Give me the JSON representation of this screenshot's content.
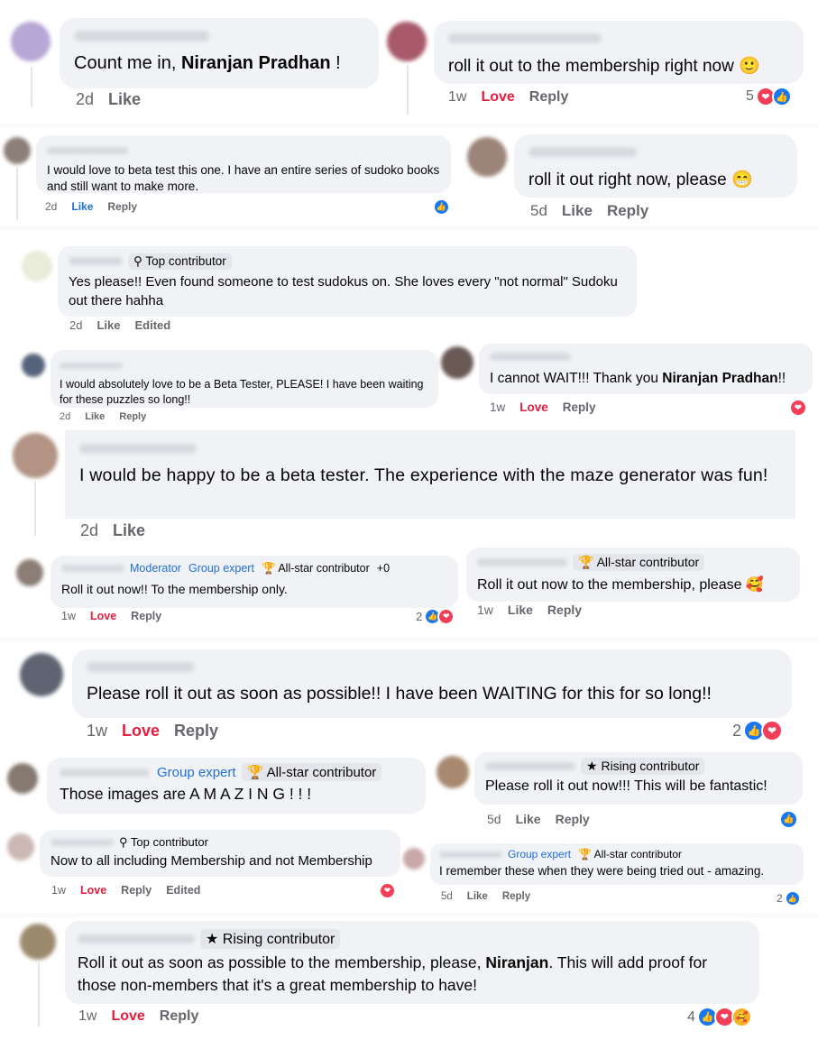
{
  "comments": [
    {
      "text_pre": "Count me in, ",
      "mention": "Niranjan Pradhan",
      "text_post": " !",
      "time": "2d",
      "like": "Like"
    },
    {
      "text": "roll it out to the membership right now 🙂",
      "time": "1w",
      "love": "Love",
      "reply": "Reply",
      "count": "5"
    },
    {
      "text": "I would love to beta test this one. I have an entire series of sudoko books and still want to make more.",
      "time": "2d",
      "like": "Like",
      "reply": "Reply"
    },
    {
      "text": "roll it out right now, please 😁",
      "time": "5d",
      "like": "Like",
      "reply": "Reply"
    },
    {
      "badge": "Top contributor",
      "text": "Yes please!! Even found someone to test sudokus on. She loves every \"not normal\" Sudoku out there hahha",
      "time": "2d",
      "like": "Like",
      "edited": "Edited"
    },
    {
      "text": "I would absolutely love to be a Beta Tester, PLEASE! I have been waiting for these puzzles so long!!",
      "time": "2d",
      "like": "Like",
      "reply": "Reply"
    },
    {
      "text_pre": "I cannot WAIT!!! Thank you ",
      "mention": "Niranjan Pradhan",
      "text_post": "!!",
      "time": "1w",
      "love": "Love",
      "reply": "Reply"
    },
    {
      "text": "I would be happy to be a beta tester. The experience with the maze generator was fun!",
      "time": "2d",
      "like": "Like"
    },
    {
      "badge_moderator": "Moderator",
      "badge_group": "Group expert",
      "badge_allstar": "All-star contributor",
      "badge_more": "+0",
      "text": "Roll it out now!! To the membership only.",
      "time": "1w",
      "love": "Love",
      "reply": "Reply",
      "count": "2"
    },
    {
      "badge": "All-star contributor",
      "text": "Roll it out now to the membership, please 🥰",
      "time": "1w",
      "like": "Like",
      "reply": "Reply"
    },
    {
      "text": "Please roll it out as soon as possible!! I have been WAITING for this for so long!!",
      "time": "1w",
      "love": "Love",
      "reply": "Reply",
      "count": "2"
    },
    {
      "badge_group": "Group expert",
      "badge_allstar": "All-star contributor",
      "text": "Those images are A M A Z I N G ! ! !"
    },
    {
      "badge": "Rising contributor",
      "text": "Please roll it out now!!! This will be fantastic!",
      "time": "5d",
      "like": "Like",
      "reply": "Reply"
    },
    {
      "badge": "Top contributor",
      "text": "Now to all including Membership and not Membership",
      "time": "1w",
      "love": "Love",
      "reply": "Reply",
      "edited": "Edited"
    },
    {
      "badge_group": "Group expert",
      "badge_allstar": "All-star contributor",
      "text": "I remember these when they were being tried out - amazing.",
      "time": "5d",
      "like": "Like",
      "reply": "Reply",
      "count": "2"
    },
    {
      "badge": "Rising contributor",
      "text_pre": "Roll it out as soon as possible to the membership, please, ",
      "mention": "Niranjan",
      "text_post": ". This will add proof for those non-members that it's a great membership to have!",
      "time": "1w",
      "love": "Love",
      "reply": "Reply",
      "count": "4"
    }
  ],
  "colors": {
    "bubble": "#f0f2f5",
    "love": "#e41e3f",
    "like_blue": "#1877f2",
    "heart": "#f33e58",
    "meta": "#65676b"
  },
  "icons": {
    "like": "thumbs-up-icon",
    "love": "heart-icon",
    "care": "care-icon",
    "badge_top": "badge-icon",
    "badge_trophy": "trophy-icon",
    "badge_star": "star-icon"
  }
}
